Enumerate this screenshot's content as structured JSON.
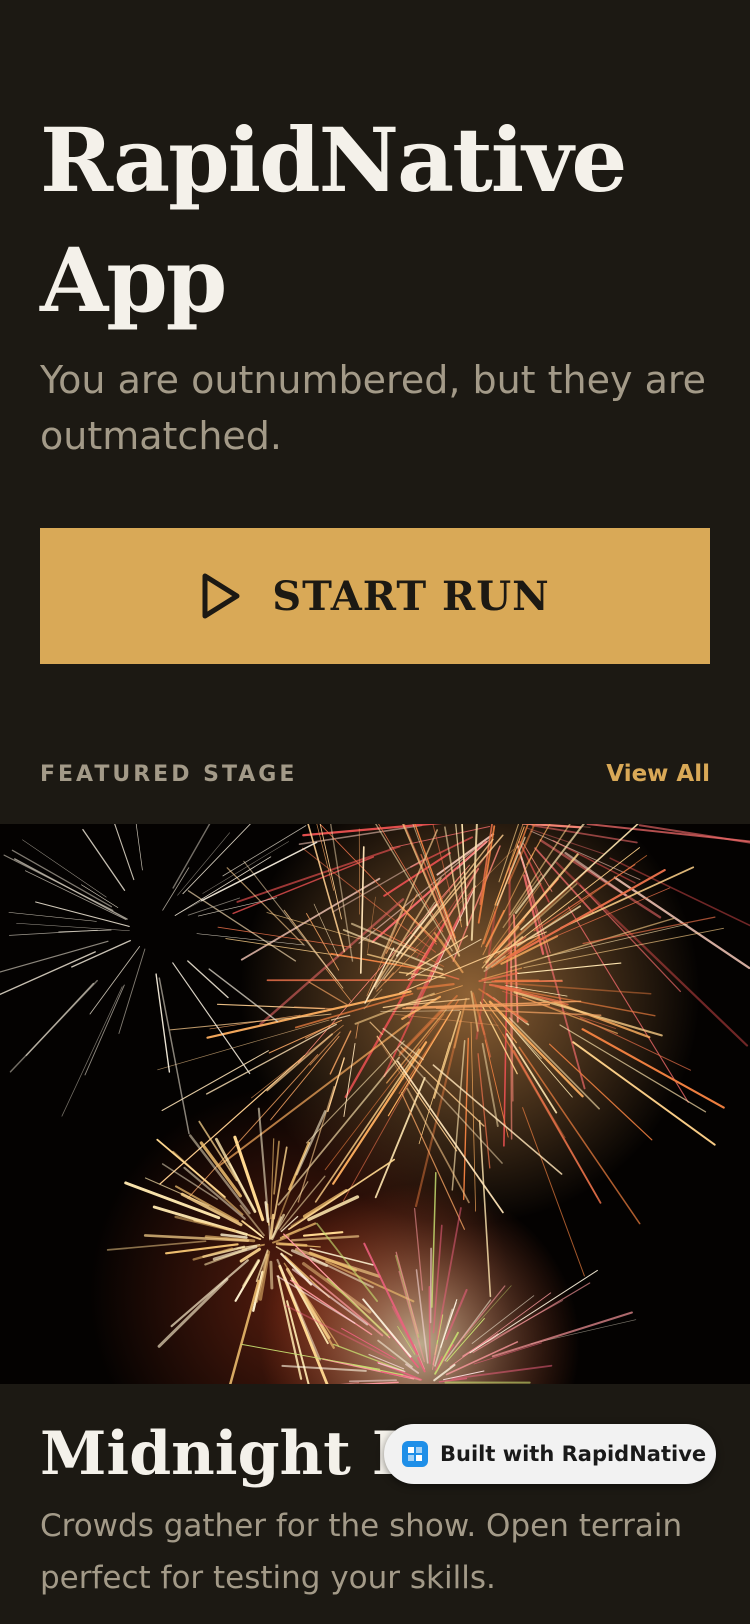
{
  "hero": {
    "title": "RapidNative App",
    "tagline": "You are outnumbered, but they are outmatched."
  },
  "primary_action": {
    "label": "START RUN",
    "icon": "play-icon"
  },
  "featured_section": {
    "title": "FEATURED STAGE",
    "view_all_label": "View All"
  },
  "featured_stage": {
    "image": "fireworks-photo",
    "title": "Midnight Fe",
    "description": "Crowds gather for the show. Open terrain perfect for testing your skills."
  },
  "badge": {
    "label": "Built with RapidNative",
    "icon": "rapidnative-logo-icon"
  },
  "colors": {
    "background": "#1c1913",
    "accent": "#d9a957",
    "text_primary": "#f4f1ea",
    "text_secondary": "#a39a88"
  }
}
